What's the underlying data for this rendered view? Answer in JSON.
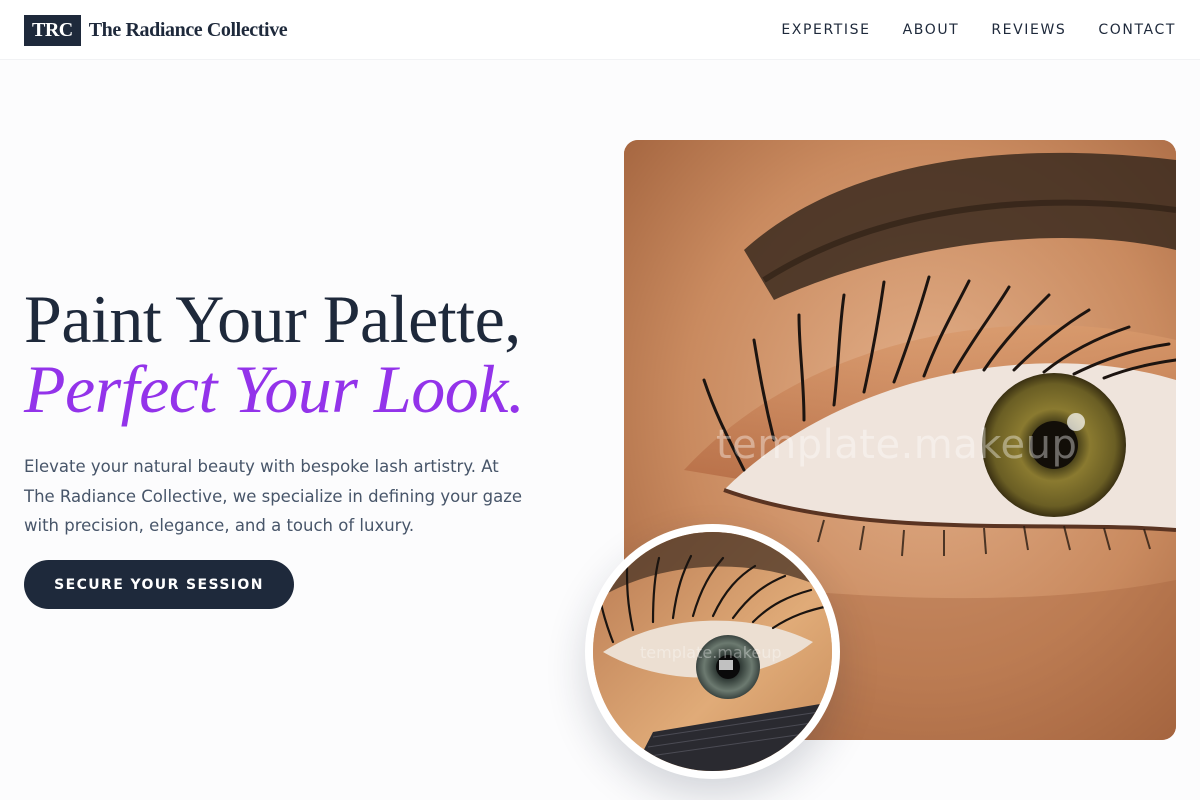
{
  "header": {
    "logo_mark": "TRC",
    "brand_name": "The Radiance Collective",
    "nav": [
      "EXPERTISE",
      "ABOUT",
      "REVIEWS",
      "CONTACT"
    ]
  },
  "hero": {
    "title_line1": "Paint Your Palette,",
    "title_line2": "Perfect Your Look.",
    "description": "Elevate your natural beauty with bespoke lash artistry. At The Radiance Collective, we specialize in defining your gaze with precision, elegance, and a touch of luxury.",
    "cta_label": "SECURE YOUR SESSION"
  },
  "images": {
    "main_watermark": "template.makeup",
    "circle_watermark": "template.makeup"
  },
  "colors": {
    "primary": "#1e293b",
    "accent": "#9333ea",
    "text_muted": "#475569",
    "background": "#fcfcfd"
  }
}
